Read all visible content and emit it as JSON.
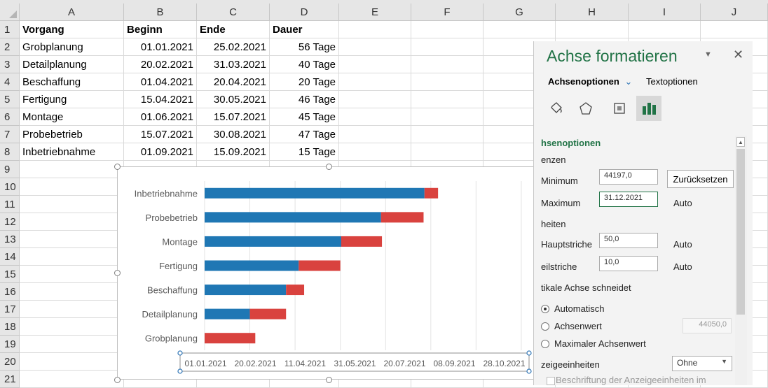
{
  "columns": [
    "A",
    "B",
    "C",
    "D",
    "E",
    "F",
    "G",
    "H",
    "I",
    "J"
  ],
  "rows": [
    "1",
    "2",
    "3",
    "4",
    "5",
    "6",
    "7",
    "8",
    "9",
    "10",
    "11",
    "12",
    "13",
    "14",
    "15",
    "16",
    "17",
    "18",
    "19",
    "20",
    "21"
  ],
  "table": {
    "header": [
      "Vorgang",
      "Beginn",
      "Ende",
      "Dauer"
    ],
    "data": [
      [
        "Grobplanung",
        "01.01.2021",
        "25.02.2021",
        "56 Tage"
      ],
      [
        "Detailplanung",
        "20.02.2021",
        "31.03.2021",
        "40 Tage"
      ],
      [
        "Beschaffung",
        "01.04.2021",
        "20.04.2021",
        "20 Tage"
      ],
      [
        "Fertigung",
        "15.04.2021",
        "30.05.2021",
        "46 Tage"
      ],
      [
        "Montage",
        "01.06.2021",
        "15.07.2021",
        "45 Tage"
      ],
      [
        "Probebetrieb",
        "15.07.2021",
        "30.08.2021",
        "47 Tage"
      ],
      [
        "Inbetriebnahme",
        "01.09.2021",
        "15.09.2021",
        "15 Tage"
      ]
    ]
  },
  "chart_data": {
    "type": "bar",
    "orientation": "horizontal",
    "stacked": true,
    "categories": [
      "Grobplanung",
      "Detailplanung",
      "Beschaffung",
      "Fertigung",
      "Montage",
      "Probebetrieb",
      "Inbetriebnahme"
    ],
    "series": [
      {
        "color": "#1f77b4",
        "offset_values": [
          44197,
          44247,
          44287,
          44301,
          44348,
          44392,
          44440
        ]
      },
      {
        "color": "#d9423e",
        "duration_values": [
          56,
          40,
          20,
          46,
          45,
          47,
          15
        ]
      }
    ],
    "x_ticks": [
      "01.01.2021",
      "20.02.2021",
      "11.04.2021",
      "31.05.2021",
      "20.07.2021",
      "08.09.2021",
      "28.10.2021"
    ],
    "xlim": [
      44197,
      44561
    ],
    "x_major_unit": 50,
    "grid": true
  },
  "pane": {
    "title": "Achse formatieren",
    "tab_axis_options": "Achsenoptionen",
    "tab_text_options": "Textoptionen",
    "section_title": "hsenoptionen",
    "limits_label": "enzen",
    "minimum_label": "Minimum",
    "minimum_value": "44197,0",
    "reset_button": "Zurücksetzen",
    "maximum_label": "Maximum",
    "maximum_value": "31.12.2021",
    "auto1": "Auto",
    "units_label": "heiten",
    "major_label": "Hauptstriche",
    "major_value": "50,0",
    "auto2": "Auto",
    "minor_label": "eilstriche",
    "minor_value": "10,0",
    "auto3": "Auto",
    "vertical_cross_label": "tikale Achse schneidet",
    "auto_radio": "Automatisch",
    "axis_value_radio": "Achsenwert",
    "axis_value": "44050,0",
    "max_axis_radio": "Maximaler Achsenwert",
    "display_units_label": "zeigeeinheiten",
    "display_units_value": "Ohne",
    "display_units_caption": "Beschriftung der Anzeigeeinheiten im"
  }
}
